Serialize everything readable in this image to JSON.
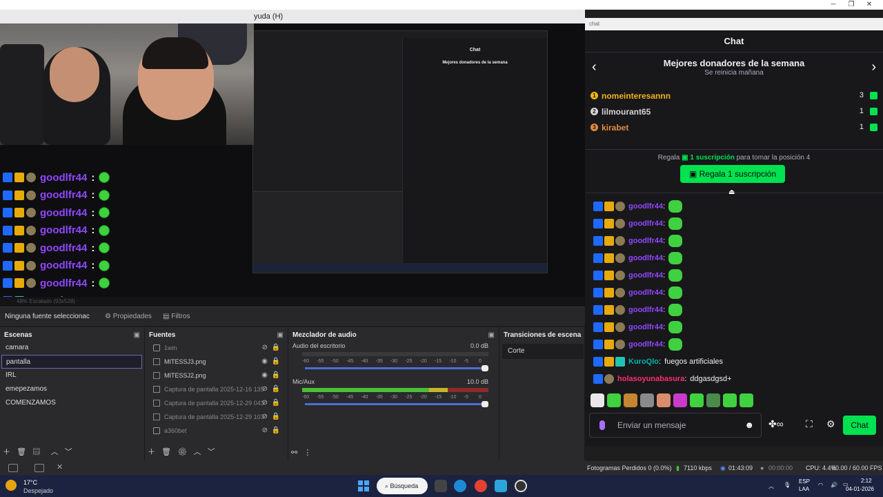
{
  "window": {
    "menu_visible": "yuda (H)",
    "min": "─",
    "max": "❐",
    "close": "✕"
  },
  "preview": {
    "overlay_chat": [
      {
        "name": "goodlfr44",
        "colon": ":",
        "badges": [
          "blue",
          "gold",
          "gray"
        ],
        "emote": true
      },
      {
        "name": "goodlfr44",
        "colon": ":",
        "badges": [
          "blue",
          "gold",
          "gray"
        ],
        "emote": true
      },
      {
        "name": "goodlfr44",
        "colon": ":",
        "badges": [
          "blue",
          "gold",
          "gray"
        ],
        "emote": true
      },
      {
        "name": "goodlfr44",
        "colon": ":",
        "badges": [
          "blue",
          "gold",
          "gray"
        ],
        "emote": true
      },
      {
        "name": "goodlfr44",
        "colon": ":",
        "badges": [
          "blue",
          "gold",
          "gray"
        ],
        "emote": true
      },
      {
        "name": "goodlfr44",
        "colon": ":",
        "badges": [
          "blue",
          "gold",
          "gray"
        ],
        "emote": true
      },
      {
        "name": "goodlfr44",
        "colon": ":",
        "badges": [
          "blue",
          "gold",
          "gray"
        ],
        "emote": true
      }
    ],
    "overlay_last": {
      "name": "KuroQlo",
      "colon": ":",
      "message": "fuegos artificiales"
    },
    "nested_chat_title": "Chat",
    "nested_donors_title": "Mejores donadores de la semana",
    "footer": "48%   Escalado (93x528)"
  },
  "toolbar": {
    "no_source": "Ninguna fuente seleccionac",
    "properties": "Propiedades",
    "filters": "Filtros"
  },
  "scenes": {
    "title": "Escenas",
    "items": [
      "camara",
      "pantalla",
      "IRL",
      "emepezamos",
      "COMENZAMOS"
    ],
    "selected": "pantalla"
  },
  "sources": {
    "title": "Fuentes",
    "items": [
      {
        "label": "1win",
        "dim": true,
        "group": true
      },
      {
        "label": "MITESSJ3.png",
        "dim": false
      },
      {
        "label": "MITESSJ2.png",
        "dim": false
      },
      {
        "label": "Captura de pantalla 2025-12-16 135",
        "dim": true
      },
      {
        "label": "Captura de pantalla 2025-12-29 043",
        "dim": true
      },
      {
        "label": "Captura de pantalla 2025-12-29 103",
        "dim": true
      },
      {
        "label": "a360bet",
        "dim": true,
        "group": true
      }
    ]
  },
  "mixer": {
    "title": "Mezclador de audio",
    "channels": [
      {
        "name": "Audio del escritorio",
        "db": "0.0 dB",
        "level_pct": 0
      },
      {
        "name": "Mic/Aux",
        "db": "10.0 dB",
        "level_pct": 72
      }
    ],
    "scale": [
      "-60",
      "-55",
      "-50",
      "-45",
      "-40",
      "-35",
      "-30",
      "-25",
      "-20",
      "-15",
      "-10",
      "-5",
      "0"
    ]
  },
  "transitions": {
    "title": "Transiciones de escena",
    "current": "Corte"
  },
  "status": {
    "dropped": "Fotogramas Perdidos 0 (0.0%)",
    "bitrate": "7110 kbps",
    "stream_time": "01:43:09",
    "rec_time": "00:00:00",
    "cpu": "CPU: 4.4%",
    "fps": "60.00 / 60.00 FPS"
  },
  "chat": {
    "address": "chat",
    "title": "Chat",
    "donors": {
      "title": "Mejores donadores de la semana",
      "subtitle": "Se reinicia mañana",
      "list": [
        {
          "rank": "1",
          "name": "nomeinteresannn",
          "count": "3",
          "color": "#f0b416"
        },
        {
          "rank": "2",
          "name": "lilmourant65",
          "count": "1",
          "color": "#d5d5d5"
        },
        {
          "rank": "3",
          "name": "kirabet",
          "count": "1",
          "color": "#e68a3c"
        }
      ]
    },
    "cta": {
      "pre": "Regala",
      "highlight": "1 suscripción",
      "post": "para tomar la posición 4",
      "button": "Regala 1 suscripción"
    },
    "messages": [
      {
        "name": "goodlfr44",
        "text": "",
        "emote": true
      },
      {
        "name": "goodlfr44",
        "text": "",
        "emote": true
      },
      {
        "name": "goodlfr44",
        "text": "",
        "emote": true
      },
      {
        "name": "goodlfr44",
        "text": "",
        "emote": true
      },
      {
        "name": "goodlfr44",
        "text": "",
        "emote": true
      },
      {
        "name": "goodlfr44",
        "text": "",
        "emote": true
      },
      {
        "name": "goodlfr44",
        "text": "",
        "emote": true
      },
      {
        "name": "goodlfr44",
        "text": "",
        "emote": true
      },
      {
        "name": "goodlfr44",
        "text": "",
        "emote": true
      },
      {
        "name": "KuroQlo",
        "text": "fuegos artificiales",
        "emote": false
      },
      {
        "name": "holasoyunabasura",
        "text": "ddgasdgsd+",
        "emote": false
      }
    ],
    "input_placeholder": "Enviar un mensaje",
    "send_label": "Chat"
  },
  "taskbar": {
    "temp": "17°C",
    "condition": "Despejado",
    "search": "Búsqueda",
    "lang1": "ESP",
    "lang2": "LAA",
    "time": "2:12",
    "date": "04-01-2026"
  },
  "colors": {
    "accent": "#00e250",
    "twitch_purple": "#9147ff",
    "obs_bg": "#2a2a2c"
  }
}
